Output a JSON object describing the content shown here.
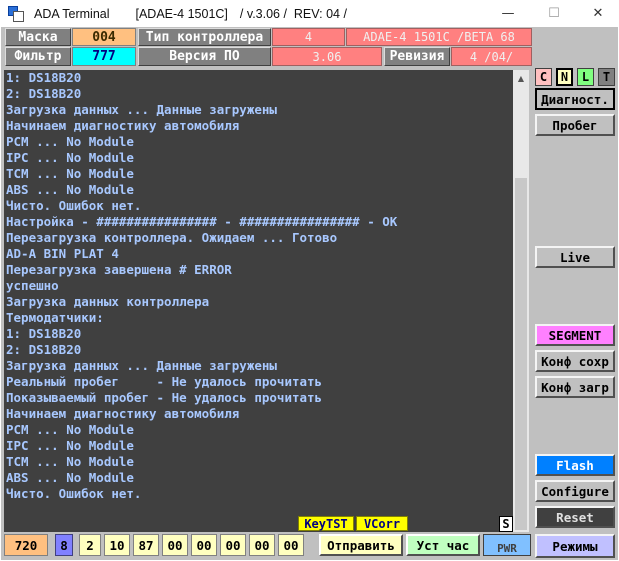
{
  "window": {
    "app_name": "ADA Terminal",
    "device": "[ADAE-4 1501C]",
    "version_text": "/ v.3.06 /  REV: 04 /",
    "minimize": "—",
    "maximize": "☐",
    "close": "✕"
  },
  "header": {
    "mask_label": "Маска",
    "mask_value": "004",
    "filter_label": "Фильтр",
    "filter_value": "777",
    "controller_type_label": "Тип контроллера",
    "controller_type_value": "4",
    "controller_type_desc": "ADAE-4 1501C /BETA 68",
    "sw_version_label": "Версия ПО",
    "sw_version_value": "3.06",
    "revision_label": "Ревизия",
    "revision_value": "4 /04/"
  },
  "terminal_lines": [
    "1: DS18B20",
    "2: DS18B20",
    "Загрузка данных ... Данные загружены",
    "Начинаем диагностику автомобиля",
    "PCM ... No Module",
    "IPC ... No Module",
    "TCM ... No Module",
    "ABS ... No Module",
    "Чисто. Ошибок нет.",
    "Настройка - ################ - ################ - OK",
    "Перезагрузка контроллера. Ожидаем ... Готово",
    "AD-A BIN PLAT 4",
    "Перезагрузка завершена # ERROR",
    "успешно",
    "Загрузка данных контроллера",
    "Термодатчики:",
    "1: DS18B20",
    "2: DS18B20",
    "Загрузка данных ... Данные загружены",
    "Реальный пробег     - Не удалось прочитать",
    "Показываемый пробег - Не удалось прочитать",
    "Начинаем диагностику автомобиля",
    "PCM ... No Module",
    "IPC ... No Module",
    "TCM ... No Module",
    "ABS ... No Module",
    "Чисто. Ошибок нет."
  ],
  "status_tags": {
    "keytst": "KeyTST",
    "vcorr": "VCorr",
    "s_button": "S"
  },
  "side_panel": {
    "mode_c": "C",
    "mode_n": "N",
    "mode_l": "L",
    "mode_t": "T",
    "diagnostics": "Диагност.",
    "mileage": "Пробег",
    "live": "Live",
    "segment": "SEGMENT",
    "conf_save": "Конф сохр",
    "conf_load": "Конф загр",
    "flash": "Flash",
    "configure": "Configure",
    "reset": "Reset",
    "modes": "Режимы"
  },
  "bottom_bar": {
    "counter": "720",
    "len": "8",
    "bytes": [
      "2",
      "10",
      "87",
      "00",
      "00",
      "00",
      "00",
      "00"
    ],
    "send": "Отправить",
    "set_clock": "Уст час",
    "pwr": "PWR"
  },
  "colors": {
    "terminal_bg": "#404040",
    "terminal_text": "#a8c8ff",
    "segment": "#ff80ff",
    "flash": "#0080ff",
    "reset": "#404040",
    "modes": "#c0c0ff",
    "send": "#ffffc0",
    "set_clock": "#c0ffc0",
    "pwr": "#80c0ff"
  }
}
